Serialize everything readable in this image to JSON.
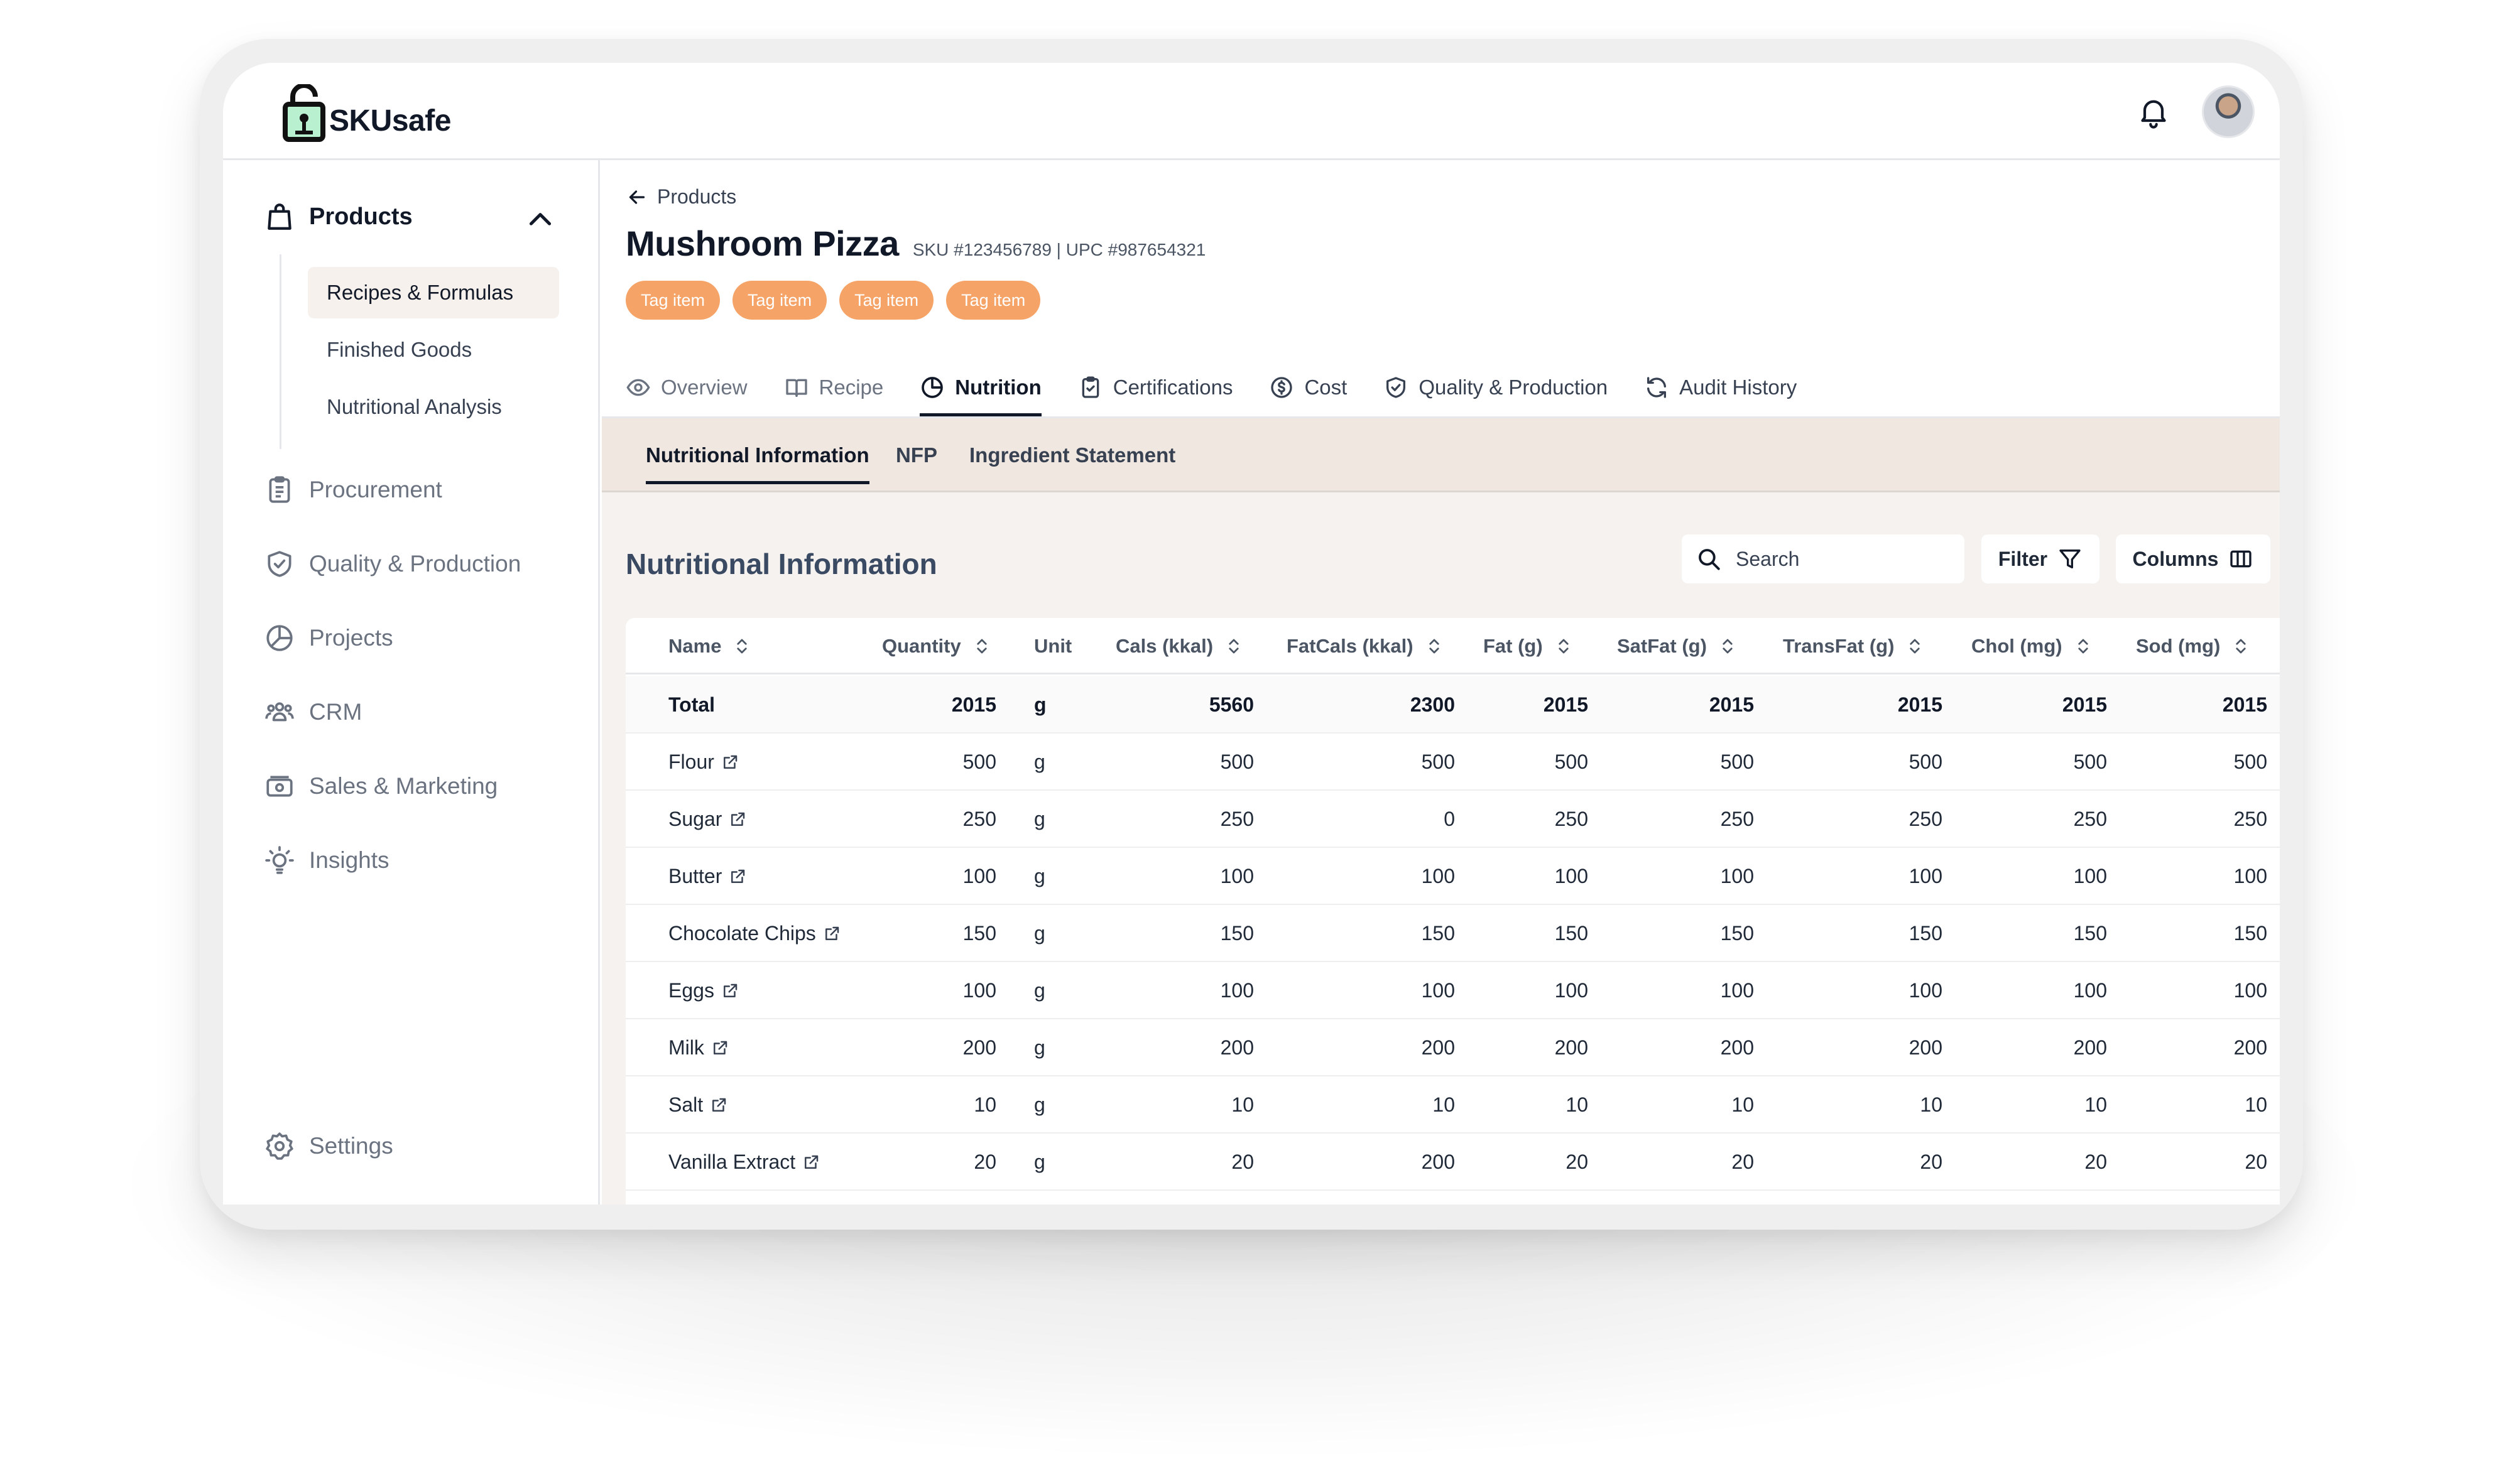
{
  "app": {
    "logo_text": "SKUsafe"
  },
  "colors": {
    "accent_tag": "#f5a367",
    "nav_active_bg": "#f6f1ec",
    "section_title": "#3b4a63"
  },
  "sidebar": {
    "products_label": "Products",
    "sub_items": [
      "Recipes & Formulas",
      "Finished Goods",
      "Nutritional Analysis"
    ],
    "items": [
      {
        "label": "Procurement",
        "icon": "clipboard-icon"
      },
      {
        "label": "Quality & Production",
        "icon": "shield-icon"
      },
      {
        "label": "Projects",
        "icon": "pie-chart-icon"
      },
      {
        "label": "CRM",
        "icon": "users-icon"
      },
      {
        "label": "Sales & Marketing",
        "icon": "money-icon"
      },
      {
        "label": "Insights",
        "icon": "lightbulb-icon"
      }
    ],
    "settings_label": "Settings"
  },
  "breadcrumb": {
    "label": "Products"
  },
  "product": {
    "title": "Mushroom Pizza",
    "meta": "SKU #123456789 | UPC #987654321",
    "tags": [
      "Tag item",
      "Tag item",
      "Tag item",
      "Tag item"
    ]
  },
  "tabs": [
    "Overview",
    "Recipe",
    "Nutrition",
    "Certifications",
    "Cost",
    "Quality & Production",
    "Audit History"
  ],
  "subtabs": [
    "Nutritional Information",
    "NFP",
    "Ingredient Statement"
  ],
  "section": {
    "title": "Nutritional Information",
    "search_placeholder": "Search",
    "filter_label": "Filter",
    "columns_label": "Columns"
  },
  "table": {
    "headers": [
      "Name",
      "Quantity",
      "Unit",
      "Cals (kkal)",
      "FatCals (kkal)",
      "Fat (g)",
      "SatFat (g)",
      "TransFat (g)",
      "Chol (mg)",
      "Sod (mg)"
    ],
    "total": {
      "name": "Total",
      "values": [
        "2015",
        "g",
        "5560",
        "2300",
        "2015",
        "2015",
        "2015",
        "2015",
        "2015"
      ]
    },
    "rows": [
      {
        "name": "Flour",
        "values": [
          "500",
          "g",
          "500",
          "500",
          "500",
          "500",
          "500",
          "500",
          "500"
        ]
      },
      {
        "name": "Sugar",
        "values": [
          "250",
          "g",
          "250",
          "0",
          "250",
          "250",
          "250",
          "250",
          "250"
        ]
      },
      {
        "name": "Butter",
        "values": [
          "100",
          "g",
          "100",
          "100",
          "100",
          "100",
          "100",
          "100",
          "100"
        ]
      },
      {
        "name": "Chocolate Chips",
        "values": [
          "150",
          "g",
          "150",
          "150",
          "150",
          "150",
          "150",
          "150",
          "150"
        ]
      },
      {
        "name": "Eggs",
        "values": [
          "100",
          "g",
          "100",
          "100",
          "100",
          "100",
          "100",
          "100",
          "100"
        ]
      },
      {
        "name": "Milk",
        "values": [
          "200",
          "g",
          "200",
          "200",
          "200",
          "200",
          "200",
          "200",
          "200"
        ]
      },
      {
        "name": "Salt",
        "values": [
          "10",
          "g",
          "10",
          "10",
          "10",
          "10",
          "10",
          "10",
          "10"
        ]
      },
      {
        "name": "Vanilla Extract",
        "values": [
          "20",
          "g",
          "20",
          "200",
          "20",
          "20",
          "20",
          "20",
          "20"
        ]
      }
    ]
  }
}
